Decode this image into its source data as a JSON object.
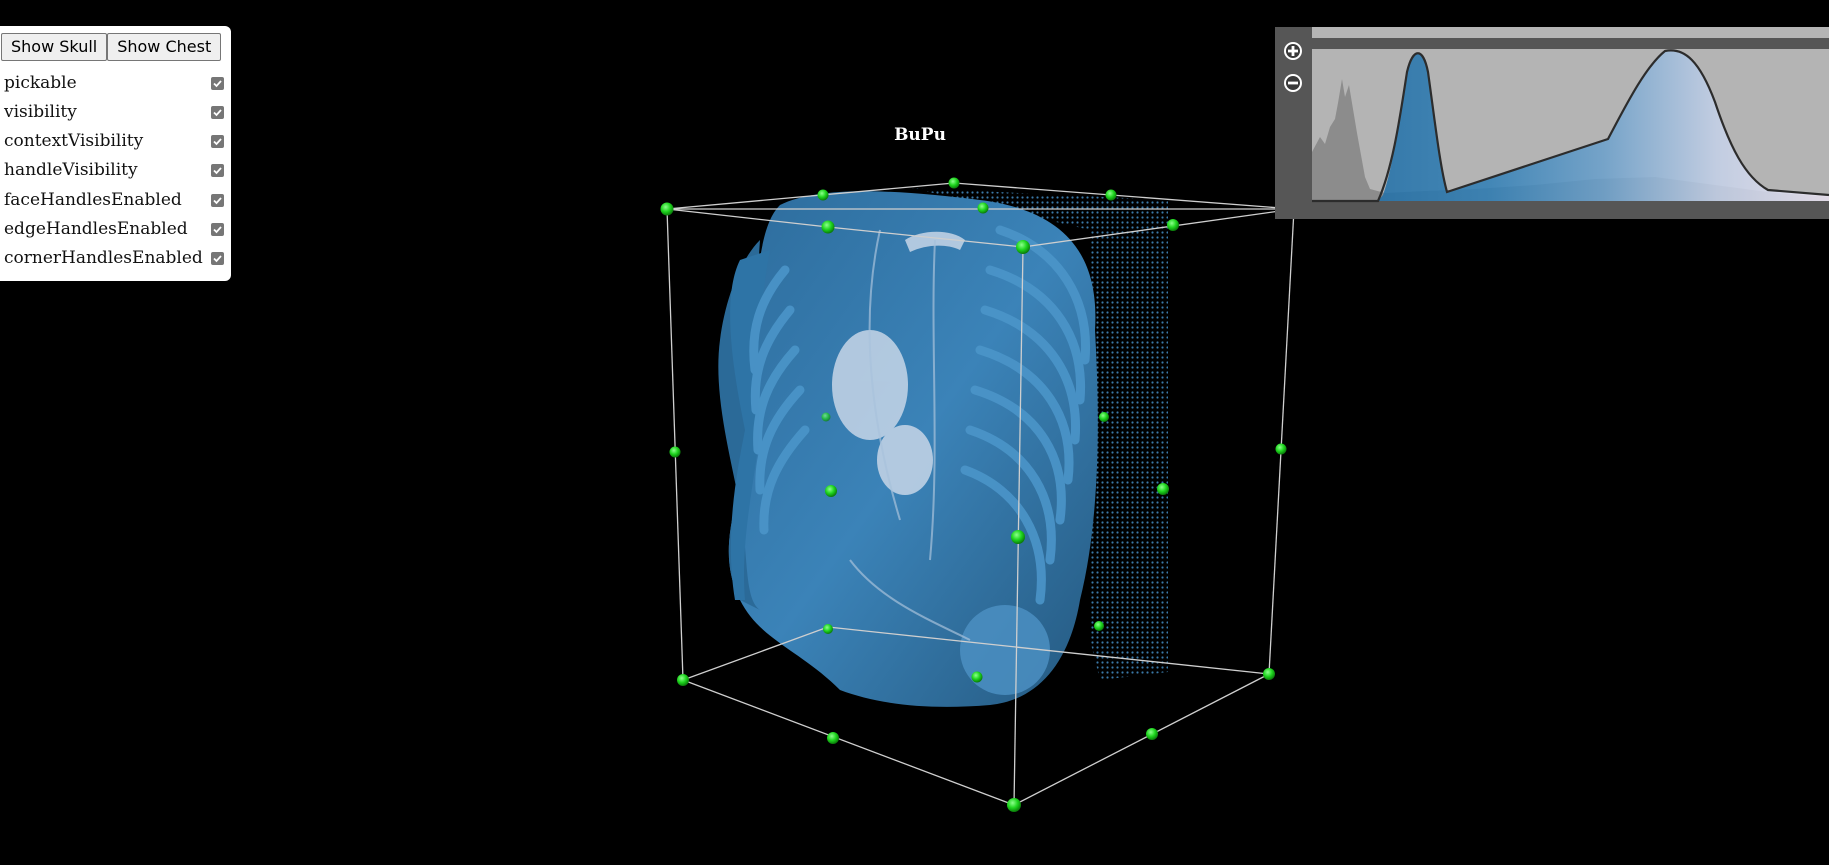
{
  "controls": {
    "buttons": [
      {
        "label": "Show Skull"
      },
      {
        "label": "Show Chest"
      }
    ],
    "options": [
      {
        "label": "pickable",
        "checked": true
      },
      {
        "label": "visibility",
        "checked": true
      },
      {
        "label": "contextVisibility",
        "checked": true
      },
      {
        "label": "handleVisibility",
        "checked": true
      },
      {
        "label": "faceHandlesEnabled",
        "checked": true
      },
      {
        "label": "edgeHandlesEnabled",
        "checked": true
      },
      {
        "label": "cornerHandlesEnabled",
        "checked": true
      }
    ]
  },
  "viewport": {
    "title": "BuPu",
    "colors": {
      "background": "#000000",
      "volume": "#2f6fa0",
      "handle": "#1ed51e",
      "box_edge": "#cccccc"
    }
  },
  "transfer_function": {
    "zoom_in_icon": "plus-circle-icon",
    "zoom_out_icon": "minus-circle-icon",
    "colors": {
      "panel": "#565656",
      "plot_bg": "#b4b4b4",
      "histogram": "#8c8c8c",
      "gradient_start": "#1f6fa8",
      "gradient_end": "#ece6f4"
    }
  }
}
